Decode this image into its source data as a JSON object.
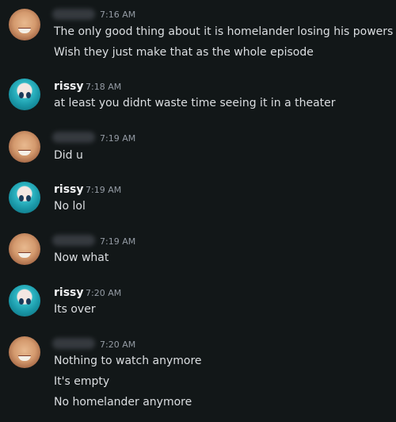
{
  "messages": [
    {
      "author": "",
      "time": "7:16 AM",
      "lines": [
        "The only good thing about it is homelander losing his powers",
        "Wish they just make that as the whole episode"
      ]
    },
    {
      "author": "rissy",
      "time": "7:18 AM",
      "lines": [
        "at least you didnt waste time seeing it in a theater"
      ]
    },
    {
      "author": "",
      "time": "7:19 AM",
      "lines": [
        "Did u"
      ]
    },
    {
      "author": "rissy",
      "time": "7:19 AM",
      "lines": [
        "No lol"
      ]
    },
    {
      "author": "",
      "time": "7:19 AM",
      "lines": [
        "Now what"
      ]
    },
    {
      "author": "rissy",
      "time": "7:20 AM",
      "lines": [
        "Its over"
      ]
    },
    {
      "author": "",
      "time": "7:20 AM",
      "lines": [
        "Nothing to watch anymore",
        "It's empty",
        "No homelander anymore"
      ]
    }
  ]
}
